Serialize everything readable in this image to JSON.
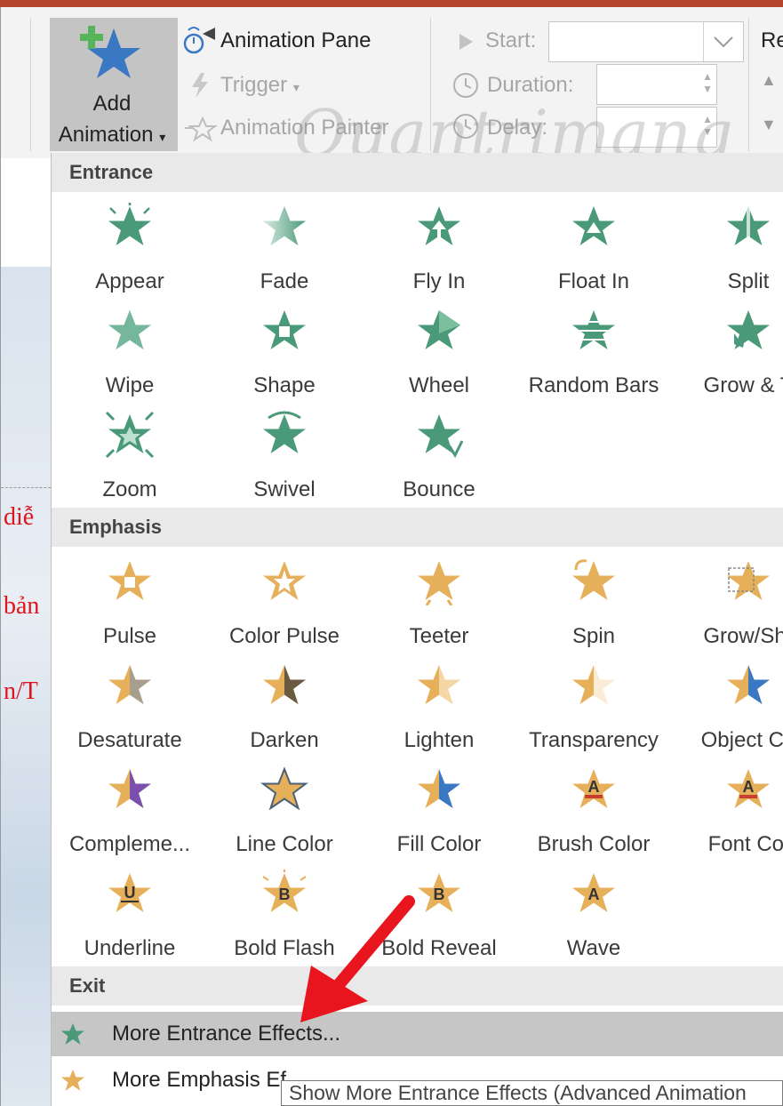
{
  "ribbon": {
    "add_animation_line1": "Add",
    "add_animation_line2": "Animation",
    "animation_pane": "Animation Pane",
    "trigger": "Trigger",
    "animation_painter": "Animation Painter",
    "start_label": "Start:",
    "duration_label": "Duration:",
    "delay_label": "Delay:",
    "reorder_partial": "Re"
  },
  "watermark": "Quantrimang",
  "slide_partial_text": [
    "diễ",
    "bản",
    "n/T"
  ],
  "sections": {
    "entrance": "Entrance",
    "emphasis": "Emphasis",
    "exit": "Exit"
  },
  "entrance_effects": [
    "Appear",
    "Fade",
    "Fly In",
    "Float In",
    "Split",
    "Wipe",
    "Shape",
    "Wheel",
    "Random Bars",
    "Grow & T",
    "Zoom",
    "Swivel",
    "Bounce"
  ],
  "emphasis_effects": [
    "Pulse",
    "Color Pulse",
    "Teeter",
    "Spin",
    "Grow/Shr",
    "Desaturate",
    "Darken",
    "Lighten",
    "Transparency",
    "Object Co",
    "Compleme...",
    "Line Color",
    "Fill Color",
    "Brush Color",
    "Font Col",
    "Underline",
    "Bold Flash",
    "Bold Reveal",
    "Wave"
  ],
  "emphasis_glyphs": {
    "brush": "A",
    "font": "A",
    "underline": "U",
    "boldflash": "B",
    "boldreveal": "B",
    "wave": "A"
  },
  "menu": {
    "more_entrance": "More Entrance Effects...",
    "more_emphasis": "More Emphasis Ef"
  },
  "tooltip": "Show More Entrance Effects (Advanced Animation",
  "colors": {
    "entrance_green": "#4a9a7a",
    "emphasis_gold": "#e6b05a",
    "arrow_red": "#e8141e",
    "ribbon_bg": "#f3f3f3",
    "accent_stripe": "#b5462c"
  }
}
